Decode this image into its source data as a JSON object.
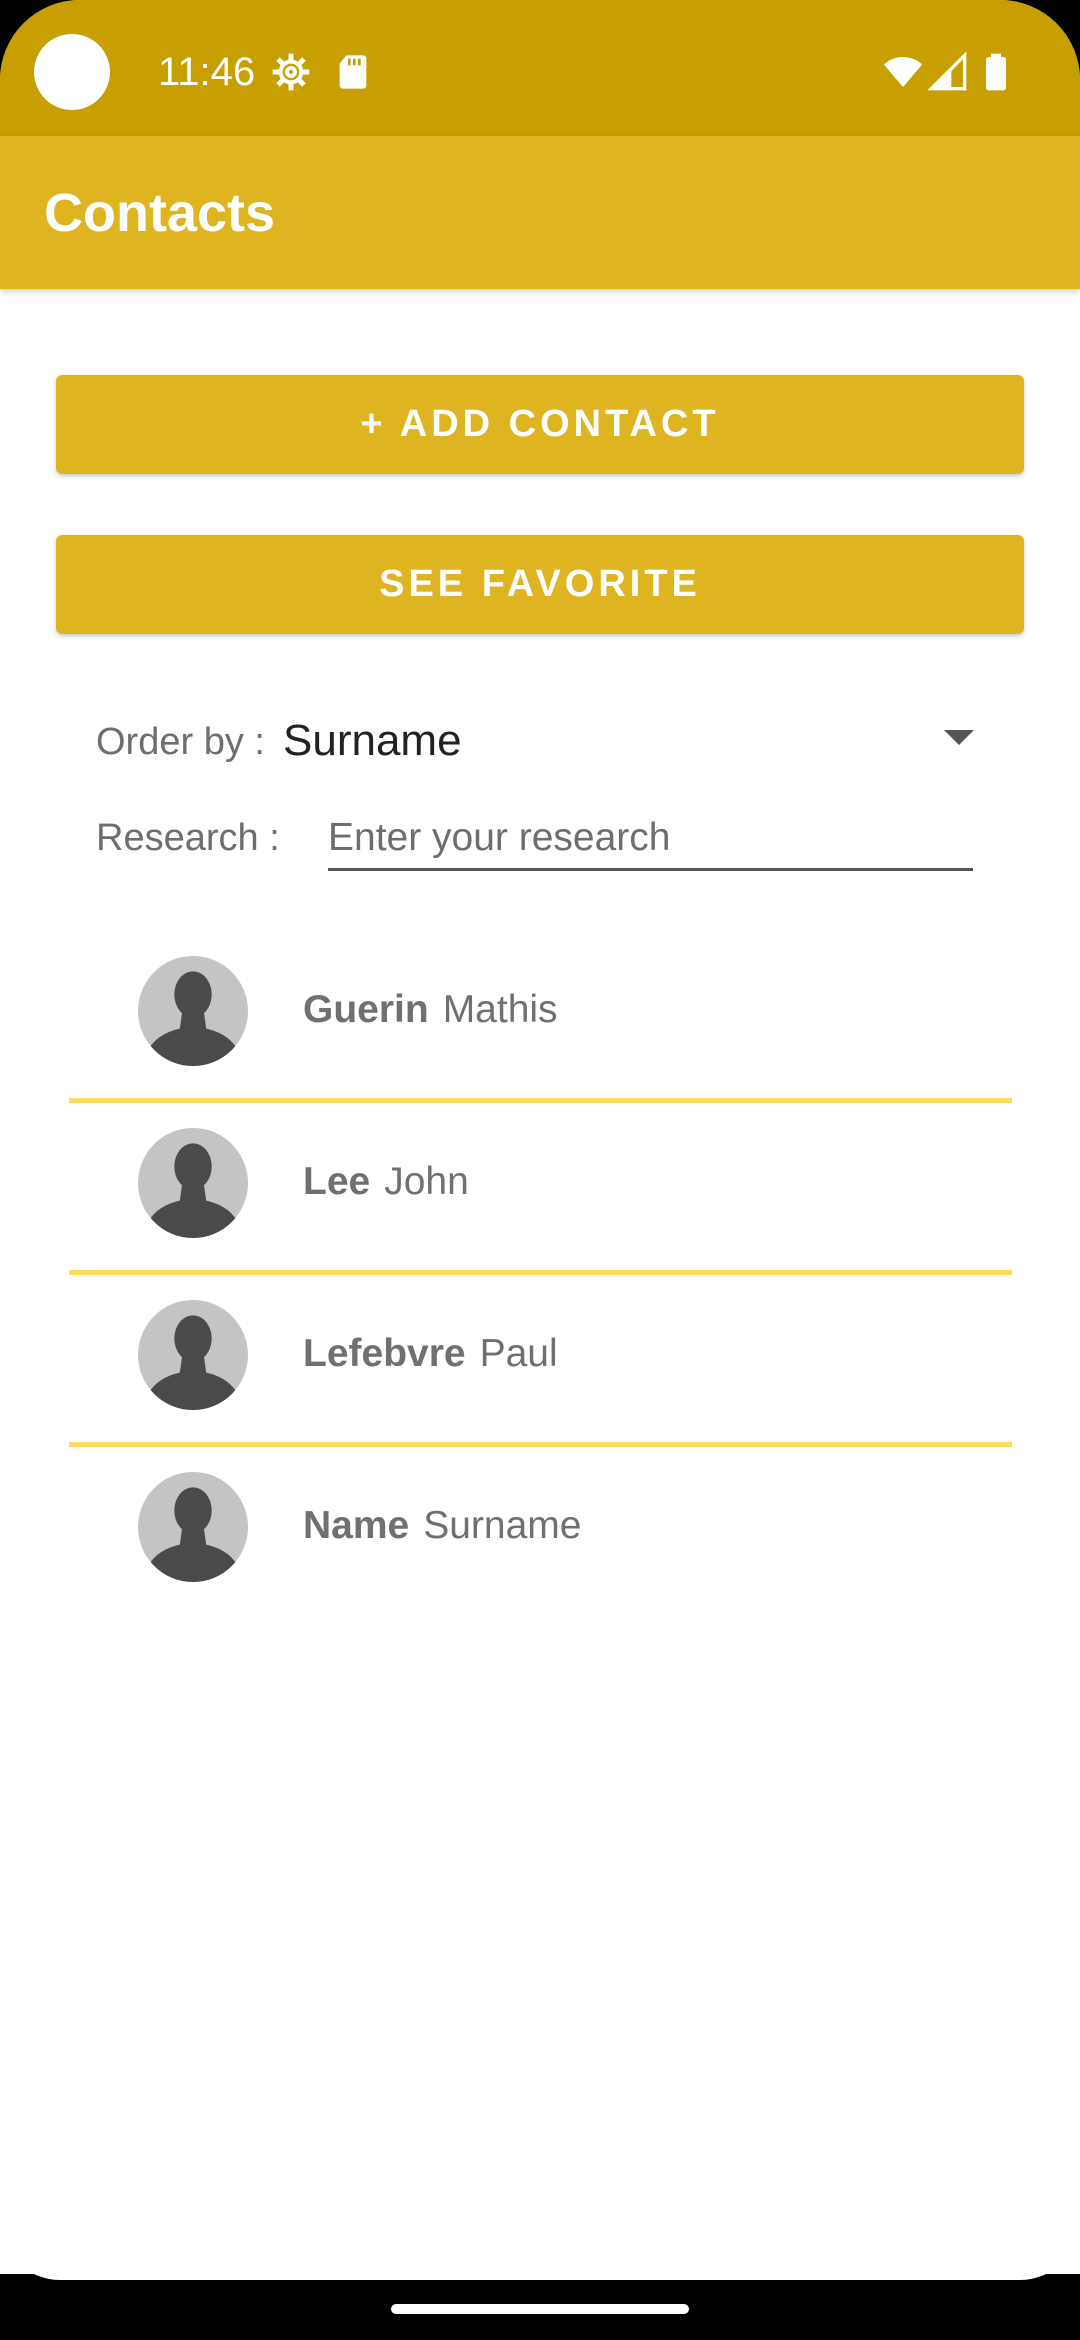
{
  "status_bar": {
    "time": "11:46",
    "color": "#C89F00",
    "left_icons": [
      "settings-gear-icon",
      "sd-card-icon"
    ],
    "right_icons": [
      "wifi-icon",
      "cell-signal-icon",
      "battery-icon"
    ]
  },
  "app_bar": {
    "title": "Contacts",
    "color": "#DEB421"
  },
  "actions": {
    "add_contact_label": "+ ADD CONTACT",
    "see_favorite_label": "SEE FAVORITE"
  },
  "filters": {
    "order_by_label": "Order by :",
    "order_by_value": "Surname",
    "research_label": "Research :",
    "research_placeholder": "Enter your research",
    "research_value": ""
  },
  "contacts": [
    {
      "surname": "Guerin",
      "first_name": "Mathis",
      "avatar": "person-silhouette-icon"
    },
    {
      "surname": "Lee",
      "first_name": "John",
      "avatar": "person-silhouette-icon"
    },
    {
      "surname": "Lefebvre",
      "first_name": "Paul",
      "avatar": "person-silhouette-icon"
    },
    {
      "surname": "Name",
      "first_name": "Surname",
      "avatar": "person-silhouette-icon"
    }
  ],
  "colors": {
    "divider": "#FFDB5C",
    "button": "#DEB421"
  }
}
